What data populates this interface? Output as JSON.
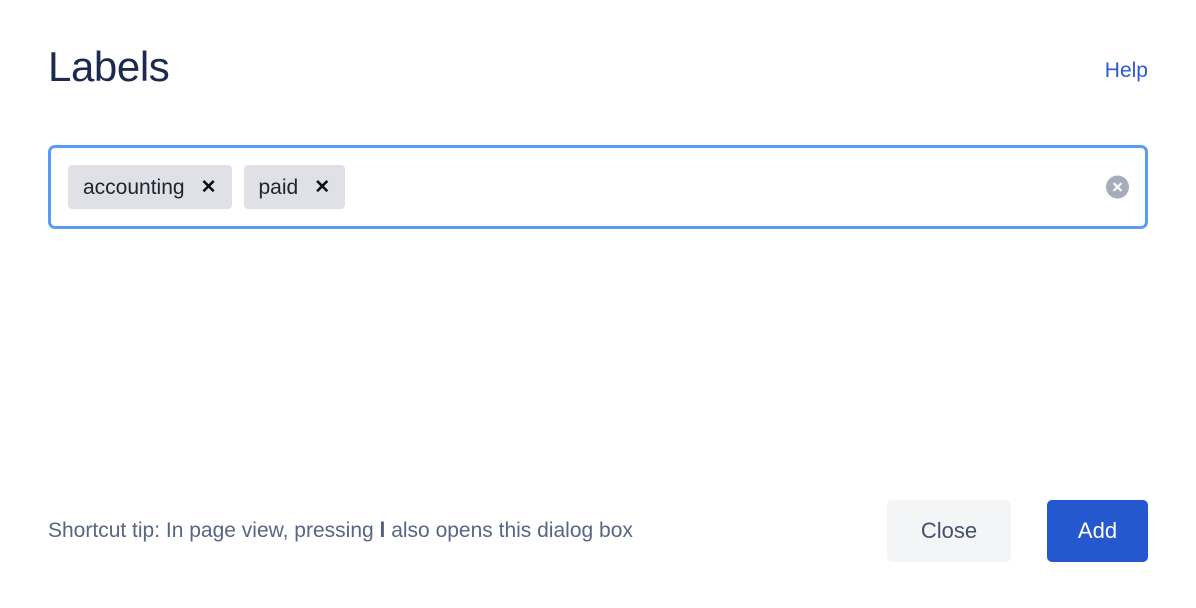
{
  "header": {
    "title": "Labels",
    "help_label": "Help"
  },
  "tag_field": {
    "tags": [
      {
        "label": "accounting",
        "remove_glyph": "✕"
      },
      {
        "label": "paid",
        "remove_glyph": "✕"
      }
    ],
    "placeholder": "",
    "value": "",
    "clear_icon": "clear-circle-icon"
  },
  "footer": {
    "tip_prefix": "Shortcut tip: In page view, pressing ",
    "tip_key": "l",
    "tip_suffix": " also opens this dialog box",
    "close_label": "Close",
    "add_label": "Add"
  },
  "colors": {
    "title": "#1b2a4e",
    "link": "#2a5ad7",
    "focus_border": "#5b9bf8",
    "tag_bg": "#dfe1e6",
    "clear_icon": "#a5adba",
    "tip_text": "#596586",
    "secondary_bg": "#f4f5f7",
    "secondary_text": "#44506b",
    "primary_bg": "#2557ce",
    "primary_text": "#ffffff",
    "page_bg": "#ffffff"
  }
}
